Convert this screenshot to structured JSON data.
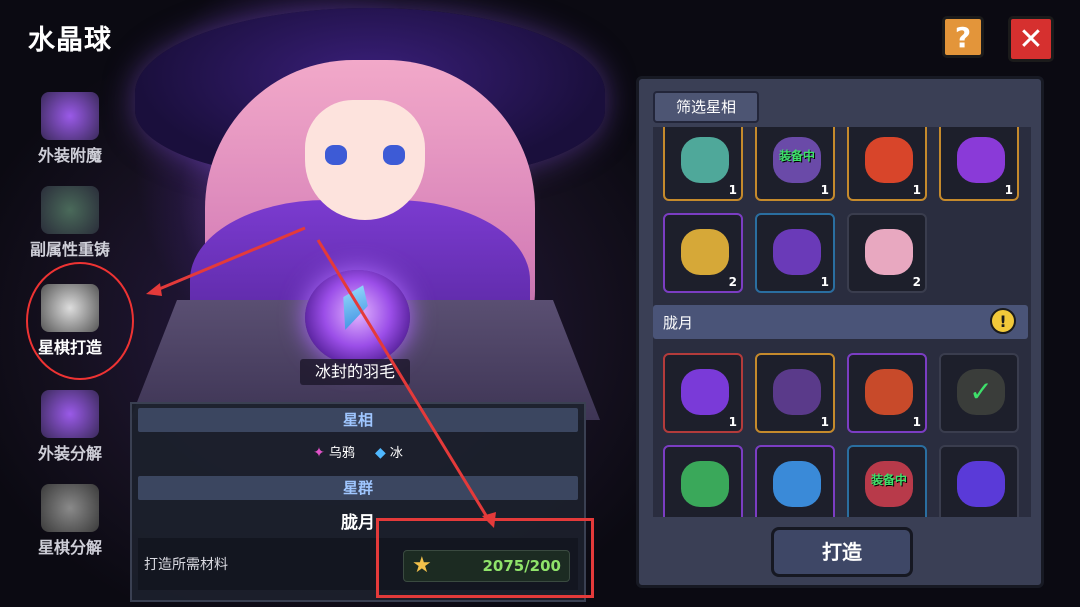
{
  "header": {
    "title": "水晶球",
    "help_icon": "question-icon",
    "close_icon": "close-icon"
  },
  "colors": {
    "accent_orange": "#e3953a",
    "close_red": "#d6302f",
    "annotation_red": "#e43a3a",
    "equipped_green": "#3ee06a"
  },
  "sidebar": {
    "items": [
      {
        "label": "外装附魔",
        "icon": "enchant-icon"
      },
      {
        "label": "副属性重铸",
        "icon": "reforge-icon"
      },
      {
        "label": "星棋打造",
        "icon": "star-chess-forge-icon",
        "active": true
      },
      {
        "label": "外装分解",
        "icon": "dismantle-icon"
      },
      {
        "label": "星棋分解",
        "icon": "star-chess-dismantle-icon"
      }
    ]
  },
  "item": {
    "name": "冰封的羽毛",
    "aspect_title": "星相",
    "traits": [
      {
        "icon": "crow-icon",
        "label": "乌鸦"
      },
      {
        "icon": "ice-icon",
        "label": "冰"
      }
    ],
    "group_title": "星群",
    "group_name": "胧月",
    "material_label": "打造所需材料",
    "material_icon": "star-icon",
    "material_count": "2075/200"
  },
  "right_panel": {
    "filter_label": "筛选星相",
    "group_label": "胧月",
    "group_icon_text": "!",
    "equipped_text": "装备中",
    "top_slots": [
      {
        "count": "1"
      },
      {
        "count": "1",
        "equipped": true
      },
      {
        "count": "1"
      },
      {
        "count": "1"
      },
      {
        "count": "2"
      },
      {
        "count": "1"
      },
      {
        "count": "2"
      }
    ],
    "bottom_slots": [
      {
        "count": "1"
      },
      {
        "count": "1"
      },
      {
        "count": "1"
      },
      {
        "count": ""
      },
      {
        "count": ""
      },
      {
        "count": ""
      },
      {
        "count": "",
        "equipped": true
      },
      {
        "count": ""
      }
    ],
    "forge_label": "打造"
  }
}
